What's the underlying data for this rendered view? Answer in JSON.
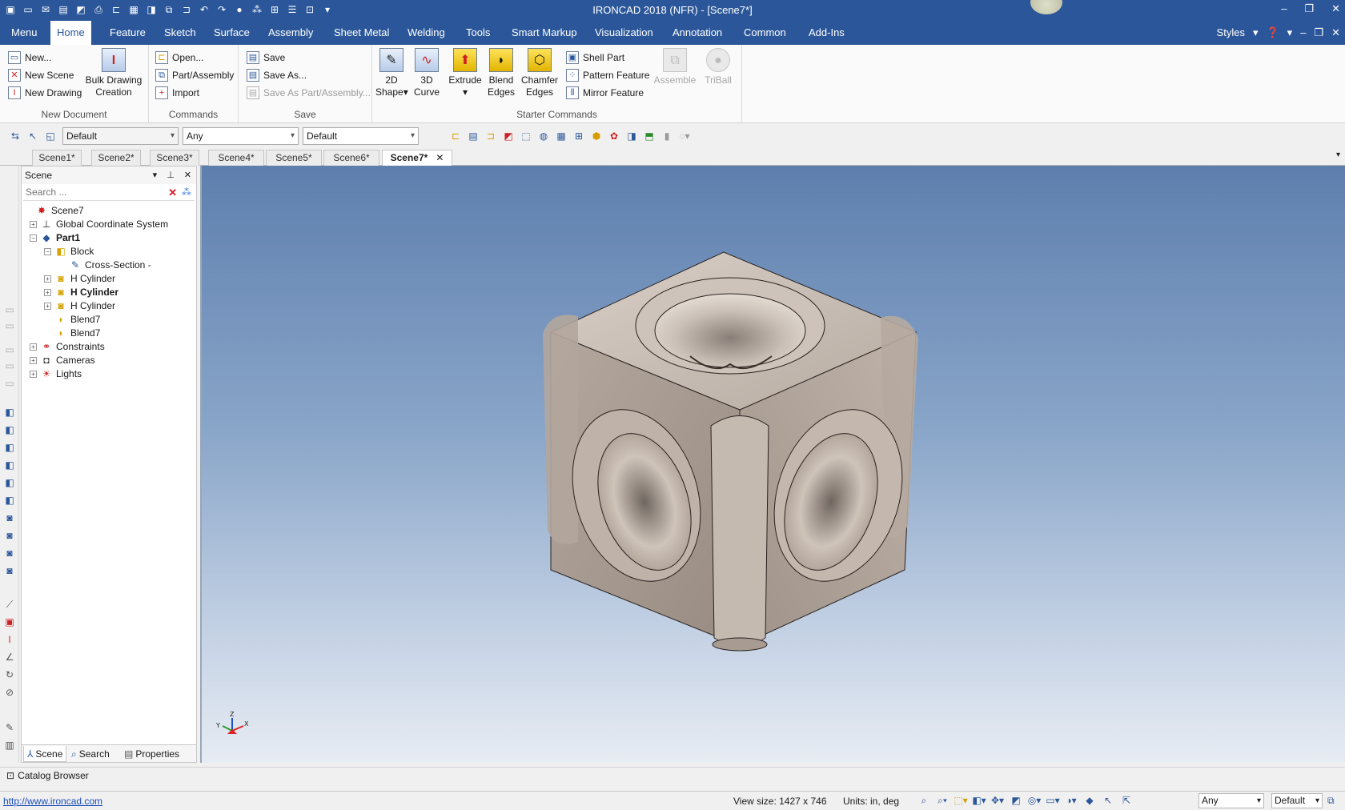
{
  "titlebar": {
    "title": "IRONCAD 2018 (NFR) - [Scene7*]",
    "quick_access_icons": [
      "app-icon",
      "new-icon",
      "open-icon",
      "save-icon",
      "drawing-icon",
      "print-icon",
      "folder-icon",
      "save-all-icon",
      "part-icon",
      "assembly-icon",
      "undo-icon",
      "redo-icon",
      "render-icon",
      "select-icon",
      "grid-icon",
      "list-icon",
      "layout-icon",
      "more-icon"
    ]
  },
  "ribbon": {
    "tabs": [
      "Menu",
      "Home",
      "Feature",
      "Sketch",
      "Surface",
      "Assembly",
      "Sheet Metal",
      "Welding",
      "Tools",
      "Smart Markup",
      "Visualization",
      "Annotation",
      "Common",
      "Add-Ins"
    ],
    "active_tab": "Home",
    "right": {
      "styles": "Styles"
    },
    "groups": {
      "new_document": {
        "label": "New Document",
        "new": "New...",
        "new_scene": "New Scene",
        "new_drawing": "New Drawing",
        "bulk_line1": "Bulk Drawing",
        "bulk_line2": "Creation"
      },
      "commands": {
        "label": "Commands",
        "open": "Open...",
        "part_assembly": "Part/Assembly",
        "import": "Import"
      },
      "save": {
        "label": "Save",
        "save": "Save",
        "save_as": "Save As...",
        "save_as_part": "Save As Part/Assembly..."
      },
      "starter": {
        "label": "Starter Commands",
        "shape2d_line1": "2D",
        "shape2d_line2": "Shape",
        "curve3d_line1": "3D",
        "curve3d_line2": "Curve",
        "extrude": "Extrude",
        "blend_line1": "Blend",
        "blend_line2": "Edges",
        "chamfer_line1": "Chamfer",
        "chamfer_line2": "Edges",
        "shell": "Shell Part",
        "pattern": "Pattern Feature",
        "mirror": "Mirror Feature",
        "assemble": "Assemble",
        "triball": "TriBall"
      }
    }
  },
  "toolbar2": {
    "combo1": "Default",
    "combo2": "Any",
    "combo3": "Default"
  },
  "scene_tabs": [
    "Scene1*",
    "Scene2*",
    "Scene3*",
    "Scene4*",
    "Scene5*",
    "Scene6*",
    "Scene7*"
  ],
  "active_scene_tab": "Scene7*",
  "scene_panel": {
    "title": "Scene",
    "search_placeholder": "Search ...",
    "tree": [
      {
        "label": "Scene7",
        "icon": "scene-icon"
      },
      {
        "label": "Global Coordinate System",
        "icon": "axes-icon"
      },
      {
        "label": "Part1",
        "icon": "part-icon"
      },
      {
        "label": "Block",
        "icon": "block-feature-icon"
      },
      {
        "label": "Cross-Section -",
        "icon": "cross-section-icon"
      },
      {
        "label": "H Cylinder",
        "icon": "cylinder-feature-icon"
      },
      {
        "label": "H Cylinder",
        "icon": "cylinder-feature-icon"
      },
      {
        "label": "H Cylinder",
        "icon": "cylinder-feature-icon"
      },
      {
        "label": "Blend7",
        "icon": "blend-icon"
      },
      {
        "label": "Blend7",
        "icon": "blend-icon"
      },
      {
        "label": "Constraints",
        "icon": "constraints-icon"
      },
      {
        "label": "Cameras",
        "icon": "camera-icon"
      },
      {
        "label": "Lights",
        "icon": "light-icon"
      }
    ],
    "bottom_tabs": [
      "Scene",
      "Search",
      "Properties"
    ]
  },
  "viewport": {
    "model": "rounded cube with spherical and cylindrical cutouts",
    "triad_labels": {
      "z": "Z",
      "y": "Y",
      "x": "X"
    }
  },
  "catalog": {
    "label": "Catalog Browser"
  },
  "statusbar": {
    "link": "http://www.ironcad.com",
    "view_size": "View size: 1427 x  746",
    "units": "Units: in, deg",
    "combo1": "Any",
    "combo2": "Default"
  },
  "colors": {
    "titlebar": "#2b579a",
    "viewport_top": "#5e7fae",
    "viewport_bottom": "#e7ecf3",
    "model": "#b8aca2"
  }
}
